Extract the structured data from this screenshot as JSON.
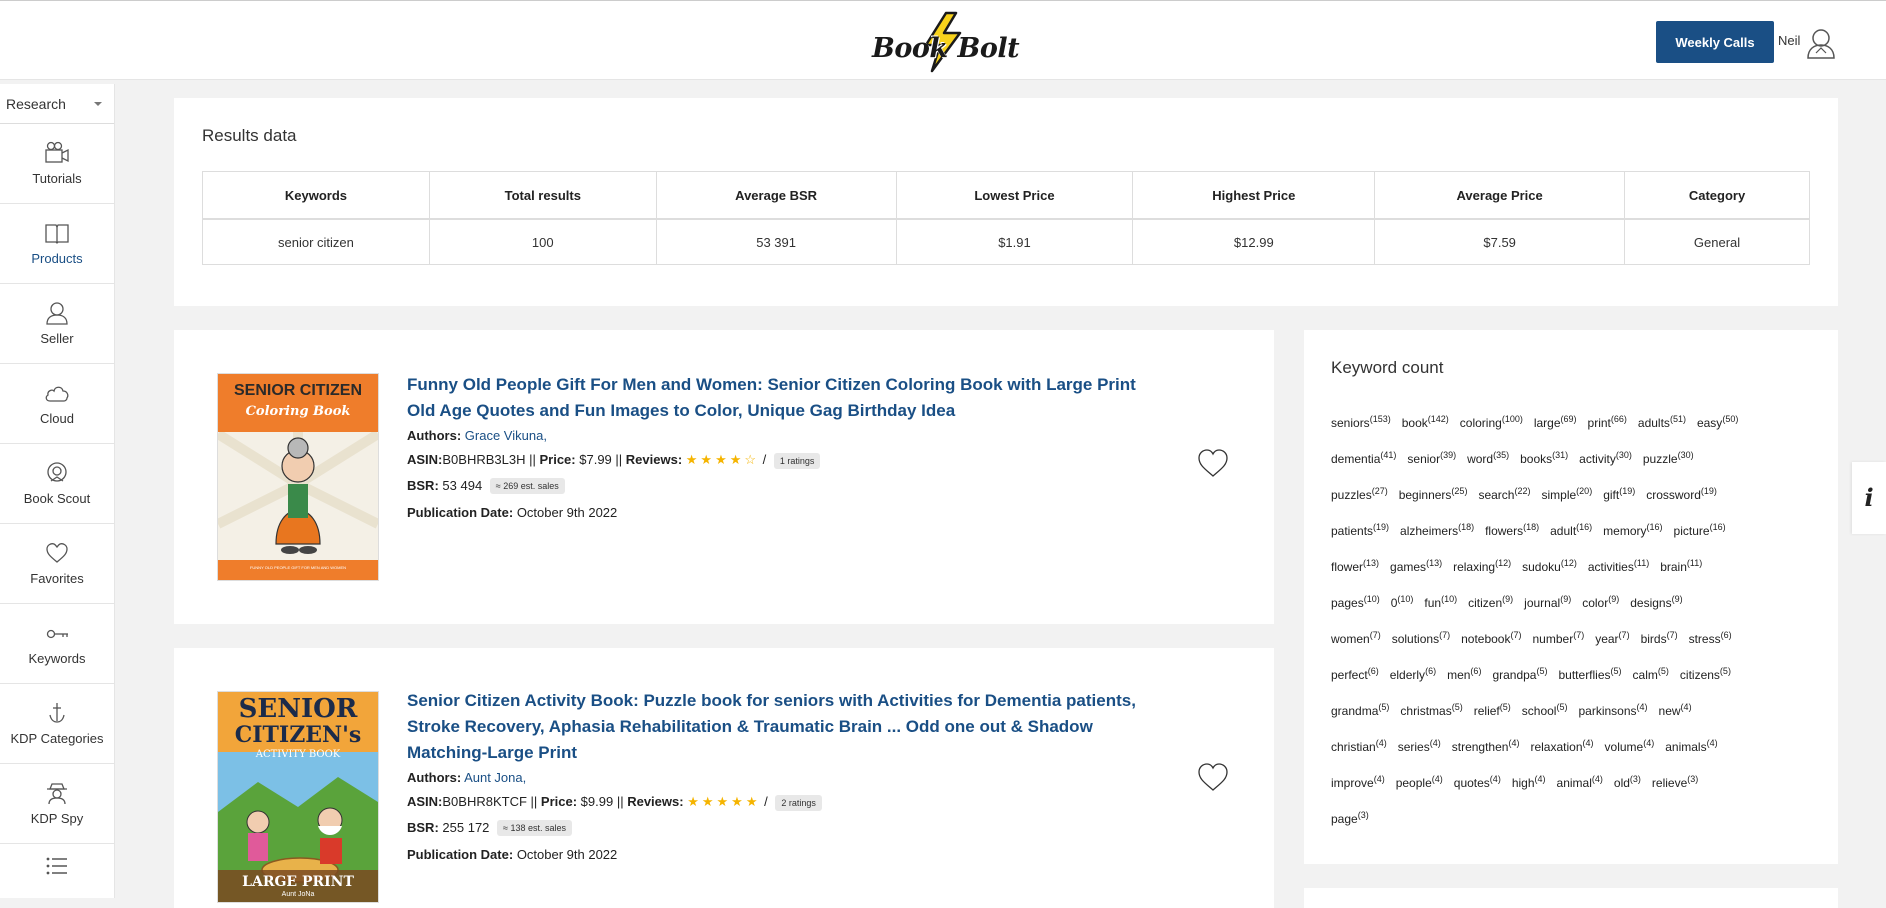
{
  "header": {
    "logo_left": "Book",
    "logo_right": "Bolt",
    "weekly_calls_label": "Weekly Calls",
    "user_name": "Neil"
  },
  "sidebar": {
    "selected": "Research",
    "items": [
      {
        "label": "Tutorials",
        "icon": "video-camera-icon"
      },
      {
        "label": "Products",
        "icon": "book-open-icon"
      },
      {
        "label": "Seller",
        "icon": "person-icon"
      },
      {
        "label": "Cloud",
        "icon": "cloud-icon"
      },
      {
        "label": "Book Scout",
        "icon": "scout-badge-icon"
      },
      {
        "label": "Favorites",
        "icon": "heart-icon"
      },
      {
        "label": "Keywords",
        "icon": "key-icon"
      },
      {
        "label": "KDP Categories",
        "icon": "anchor-icon"
      },
      {
        "label": "KDP Spy",
        "icon": "spy-icon"
      }
    ]
  },
  "results": {
    "title": "Results data",
    "headers": [
      "Keywords",
      "Total results",
      "Average BSR",
      "Lowest Price",
      "Highest Price",
      "Average Price",
      "Category"
    ],
    "row": [
      "senior citizen",
      "100",
      "53 391",
      "$1.91",
      "$12.99",
      "$7.59",
      "General"
    ]
  },
  "books": [
    {
      "title": "Funny Old People Gift For Men and Women: Senior Citizen Coloring Book with Large Print Old Age Quotes and Fun Images to Color, Unique Gag Birthday Idea",
      "authors_label": "Authors:",
      "author": "Grace Vikuna,",
      "asin_label": "ASIN:",
      "asin": "B0BHRB3L3H",
      "price_label": "Price:",
      "price": "$7.99",
      "reviews_label": "Reviews:",
      "stars": "★★★★☆",
      "rating_stars": 4,
      "ratings": "1 ratings",
      "bsr_label": "BSR:",
      "bsr": "53 494",
      "est_sales": "≈ 269 est. sales",
      "pub_label": "Publication Date:",
      "pub_date": "October 9th 2022",
      "cover": {
        "top": "SENIOR CITIZEN",
        "sub": "Coloring Book",
        "bottom": "FUNNY OLD PEOPLE GIFT FOR MEN AND WOMEN"
      }
    },
    {
      "title": "Senior Citizen Activity Book: Puzzle book for seniors with Activities for Dementia patients, Stroke Recovery, Aphasia Rehabilitation & Traumatic Brain ... Odd one out & Shadow Matching-Large Print",
      "authors_label": "Authors:",
      "author": "Aunt Jona,",
      "asin_label": "ASIN:",
      "asin": "B0BHR8KTCF",
      "price_label": "Price:",
      "price": "$9.99",
      "reviews_label": "Reviews:",
      "stars": "★★★★★",
      "rating_stars": 5,
      "ratings": "2 ratings",
      "bsr_label": "BSR:",
      "bsr": "255 172",
      "est_sales": "≈ 138 est. sales",
      "pub_label": "Publication Date:",
      "pub_date": "October 9th 2022",
      "cover": {
        "top": "SENIOR",
        "mid": "CITIZEN's",
        "sub": "ACTIVITY BOOK",
        "bottom": "LARGE PRINT",
        "author": "Aunt JoNa"
      }
    }
  ],
  "keywords": {
    "title": "Keyword count",
    "rows": [
      [
        [
          "seniors",
          "153"
        ],
        [
          "book",
          "142"
        ],
        [
          "coloring",
          "100"
        ],
        [
          "large",
          "69"
        ],
        [
          "print",
          "66"
        ],
        [
          "adults",
          "51"
        ],
        [
          "easy",
          "50"
        ]
      ],
      [
        [
          "dementia",
          "41"
        ],
        [
          "senior",
          "39"
        ],
        [
          "word",
          "35"
        ],
        [
          "books",
          "31"
        ],
        [
          "activity",
          "30"
        ],
        [
          "puzzle",
          "30"
        ]
      ],
      [
        [
          "puzzles",
          "27"
        ],
        [
          "beginners",
          "25"
        ],
        [
          "search",
          "22"
        ],
        [
          "simple",
          "20"
        ],
        [
          "gift",
          "19"
        ],
        [
          "crossword",
          "19"
        ]
      ],
      [
        [
          "patients",
          "19"
        ],
        [
          "alzheimers",
          "18"
        ],
        [
          "flowers",
          "18"
        ],
        [
          "adult",
          "16"
        ],
        [
          "memory",
          "16"
        ],
        [
          "picture",
          "16"
        ]
      ],
      [
        [
          "flower",
          "13"
        ],
        [
          "games",
          "13"
        ],
        [
          "relaxing",
          "12"
        ],
        [
          "sudoku",
          "12"
        ],
        [
          "activities",
          "11"
        ],
        [
          "brain",
          "11"
        ]
      ],
      [
        [
          "pages",
          "10"
        ],
        [
          "0",
          "10"
        ],
        [
          "fun",
          "10"
        ],
        [
          "citizen",
          "9"
        ],
        [
          "journal",
          "9"
        ],
        [
          "color",
          "9"
        ],
        [
          "designs",
          "9"
        ]
      ],
      [
        [
          "women",
          "7"
        ],
        [
          "solutions",
          "7"
        ],
        [
          "notebook",
          "7"
        ],
        [
          "number",
          "7"
        ],
        [
          "year",
          "7"
        ],
        [
          "birds",
          "7"
        ],
        [
          "stress",
          "6"
        ]
      ],
      [
        [
          "perfect",
          "6"
        ],
        [
          "elderly",
          "6"
        ],
        [
          "men",
          "6"
        ],
        [
          "grandpa",
          "5"
        ],
        [
          "butterflies",
          "5"
        ],
        [
          "calm",
          "5"
        ],
        [
          "citizens",
          "5"
        ]
      ],
      [
        [
          "grandma",
          "5"
        ],
        [
          "christmas",
          "5"
        ],
        [
          "relief",
          "5"
        ],
        [
          "school",
          "5"
        ],
        [
          "parkinsons",
          "4"
        ],
        [
          "new",
          "4"
        ]
      ],
      [
        [
          "christian",
          "4"
        ],
        [
          "series",
          "4"
        ],
        [
          "strengthen",
          "4"
        ],
        [
          "relaxation",
          "4"
        ],
        [
          "volume",
          "4"
        ],
        [
          "animals",
          "4"
        ]
      ],
      [
        [
          "improve",
          "4"
        ],
        [
          "people",
          "4"
        ],
        [
          "quotes",
          "4"
        ],
        [
          "high",
          "4"
        ],
        [
          "animal",
          "4"
        ],
        [
          "old",
          "3"
        ],
        [
          "relieve",
          "3"
        ]
      ],
      [
        [
          "page",
          "3"
        ]
      ]
    ]
  },
  "info_tab": "i",
  "colors": {
    "brand_blue": "#1a4f85",
    "star": "#f5b400",
    "bolt_yellow": "#f7d21c"
  }
}
